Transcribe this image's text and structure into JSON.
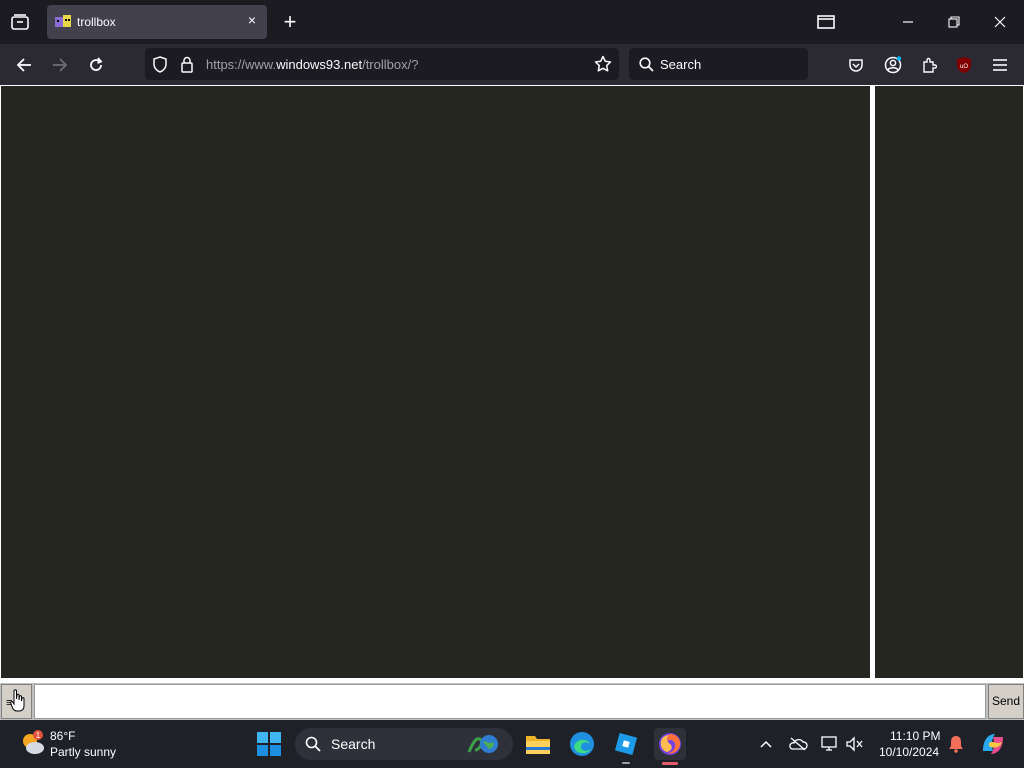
{
  "browser": {
    "tab": {
      "title": "trollbox",
      "close_glyph": "×"
    },
    "new_tab_glyph": "+",
    "url": {
      "prefix": "https://www.",
      "host": "windows93.net",
      "path": "/trollbox/?"
    },
    "search_placeholder": "Search"
  },
  "trollbox": {
    "menu_label": "≡",
    "input_value": "",
    "send_label": "Send",
    "background_color": "#262620"
  },
  "taskbar": {
    "weather": {
      "temp": "86°F",
      "condition": "Partly sunny",
      "badge": "1"
    },
    "search_label": "Search",
    "clock": {
      "time": "11:10 PM",
      "date": "10/10/2024"
    }
  }
}
